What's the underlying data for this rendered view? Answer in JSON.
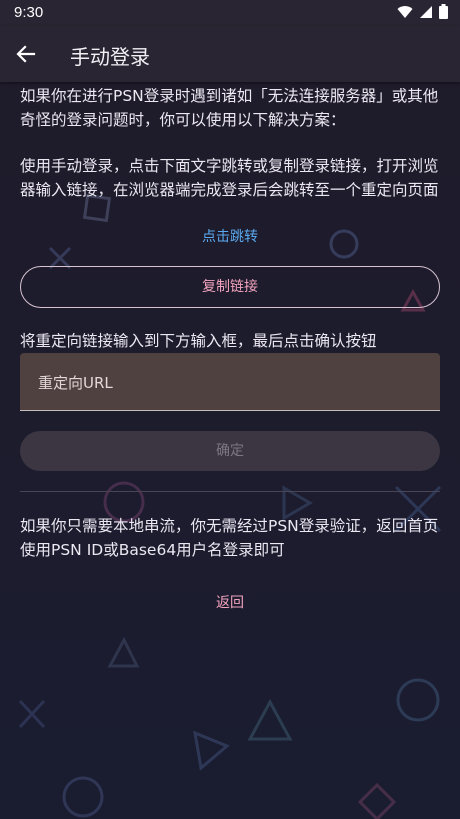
{
  "status_bar": {
    "time": "9:30",
    "icons": [
      "wifi-icon",
      "signal-icon",
      "battery-icon"
    ]
  },
  "app_bar": {
    "title": "手动登录",
    "back_icon": "arrow-left-icon"
  },
  "main": {
    "intro": "如果你在进行PSN登录时遇到诸如「无法连接服务器」或其他奇怪的登录问题时，你可以使用以下解决方案：",
    "instructions": "使用手动登录，点击下面文字跳转或复制登录链接，打开浏览器输入链接，在浏览器端完成登录后会跳转至一个重定向页面",
    "jump_link": "点击跳转",
    "copy_button": "复制链接",
    "redirect_hint": "将重定向链接输入到下方输入框，最后点击确认按钮",
    "redirect_input": {
      "placeholder": "重定向URL",
      "value": ""
    },
    "confirm_button": "确定",
    "local_note": "如果你只需要本地串流，你无需经过PSN登录验证，返回首页使用PSN ID或Base64用户名登录即可",
    "back_link": "返回"
  },
  "colors": {
    "background": "#1c1a2d",
    "app_bar": "#2a2532",
    "link_blue": "#5aa9ef",
    "accent_pink": "#f2a3bd",
    "input_fill": "#4f4140",
    "disabled_button": "#3b3642"
  }
}
